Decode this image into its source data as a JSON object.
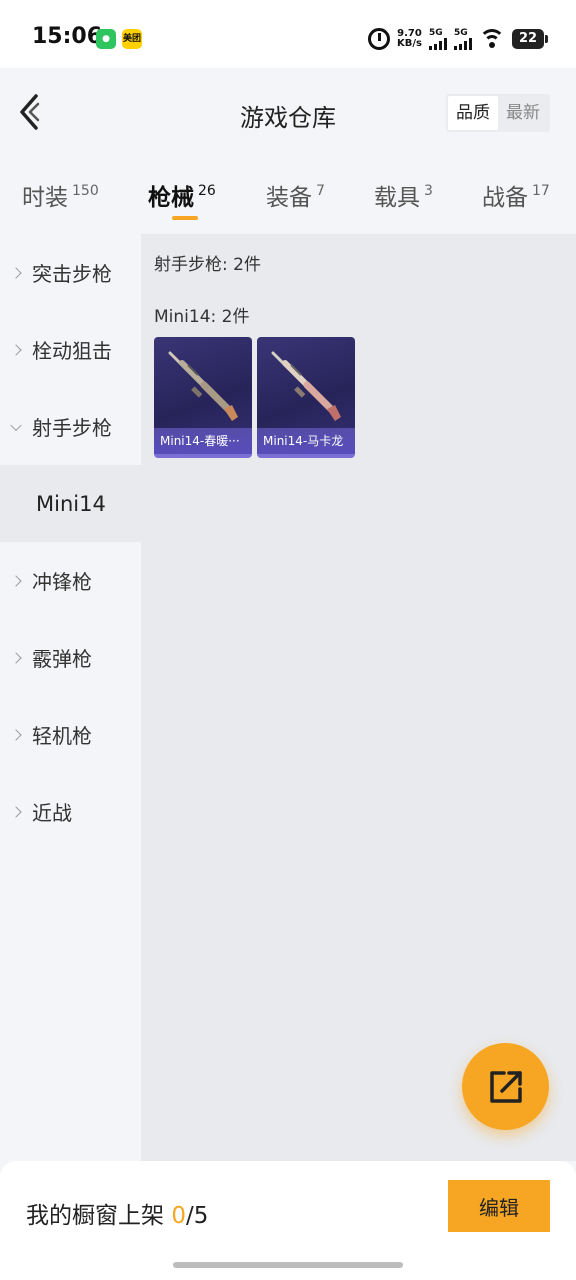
{
  "status_bar": {
    "time": "15:06",
    "apps": [
      "wechat",
      "美团"
    ],
    "net_speed_value": "9.70",
    "net_speed_unit": "KB/s",
    "signal_label": "5G",
    "battery": "22"
  },
  "header": {
    "title": "游戏仓库",
    "sort_options": [
      "品质",
      "最新"
    ],
    "sort_selected": "品质"
  },
  "categories": [
    {
      "label": "时装",
      "count": "150"
    },
    {
      "label": "枪械",
      "count": "26",
      "active": true
    },
    {
      "label": "装备",
      "count": "7"
    },
    {
      "label": "载具",
      "count": "3"
    },
    {
      "label": "战备",
      "count": "17"
    }
  ],
  "sidebar": {
    "items": [
      {
        "label": "突击步枪",
        "expanded": false
      },
      {
        "label": "栓动狙击",
        "expanded": false
      },
      {
        "label": "射手步枪",
        "expanded": true
      },
      {
        "label": "Mini14",
        "sub": true
      },
      {
        "label": "冲锋枪",
        "expanded": false
      },
      {
        "label": "霰弹枪",
        "expanded": false
      },
      {
        "label": "轻机枪",
        "expanded": false
      },
      {
        "label": "近战",
        "expanded": false
      }
    ]
  },
  "content": {
    "group_title": "射手步枪: 2件",
    "sub_title": "Mini14: 2件",
    "items": [
      {
        "name": "Mini14-春暖···"
      },
      {
        "name": "Mini14-马卡龙"
      }
    ]
  },
  "bottom": {
    "showcase_label": "我的橱窗上架",
    "showcase_count": "0",
    "showcase_total": "/5",
    "edit_label": "编辑"
  },
  "colors": {
    "accent": "#f6a623",
    "card_bg": "#2b2760",
    "card_label": "#6f62d0"
  }
}
